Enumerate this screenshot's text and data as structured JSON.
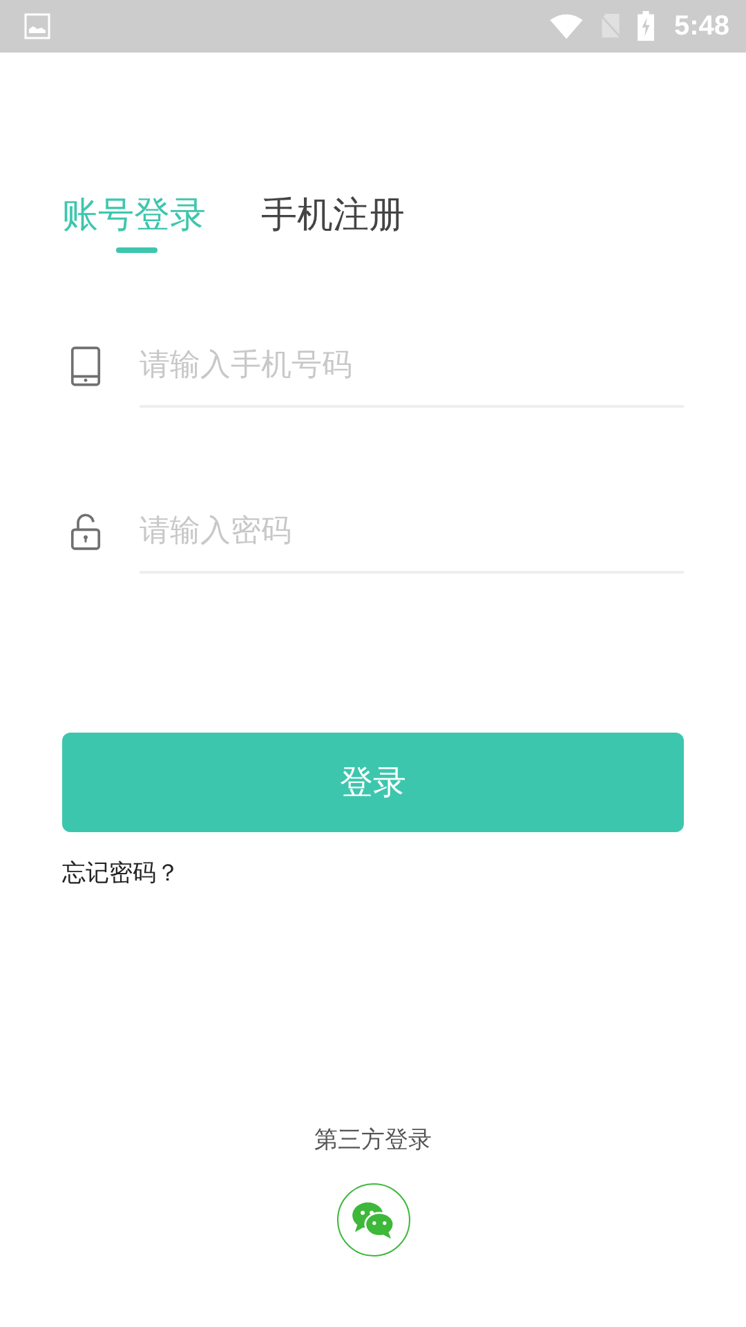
{
  "status_bar": {
    "time": "5:48"
  },
  "tabs": [
    {
      "label": "账号登录",
      "selected": true
    },
    {
      "label": "手机注册",
      "selected": false
    }
  ],
  "fields": [
    {
      "kind": "phone",
      "placeholder": "请输入手机号码"
    },
    {
      "kind": "password",
      "placeholder": "请输入密码"
    }
  ],
  "login_button": "登录",
  "forgot_link": "忘记密码？",
  "third_party": {
    "title": "第三方登录"
  }
}
